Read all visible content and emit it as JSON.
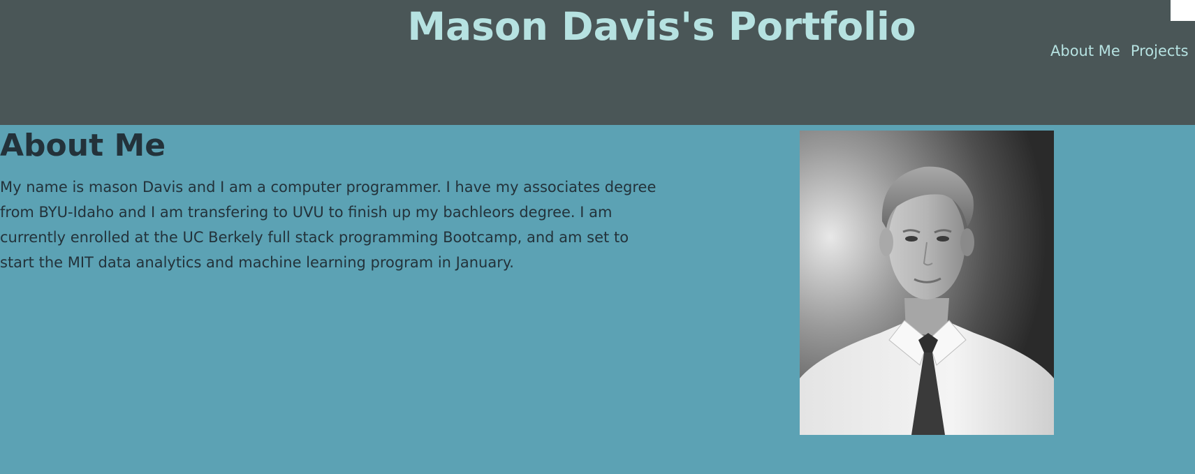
{
  "header": {
    "title": "Mason Davis's Portfolio",
    "nav": [
      {
        "label": "About Me"
      },
      {
        "label": "Projects"
      }
    ]
  },
  "about": {
    "heading": "About Me",
    "paragraph": "My name is mason Davis and I am a computer programmer. I have my associates degree from BYU-Idaho and I am transfering to UVU to finish up my bachleors degree. I am currently enrolled at the UC Berkely full stack programming Bootcamp, and am set to start the MIT data analytics and machine learning program in January."
  },
  "colors": {
    "header_bg": "#4a5657",
    "page_bg": "#5ca2b4",
    "title_text": "#b6e2e1",
    "body_text": "#23323a"
  }
}
